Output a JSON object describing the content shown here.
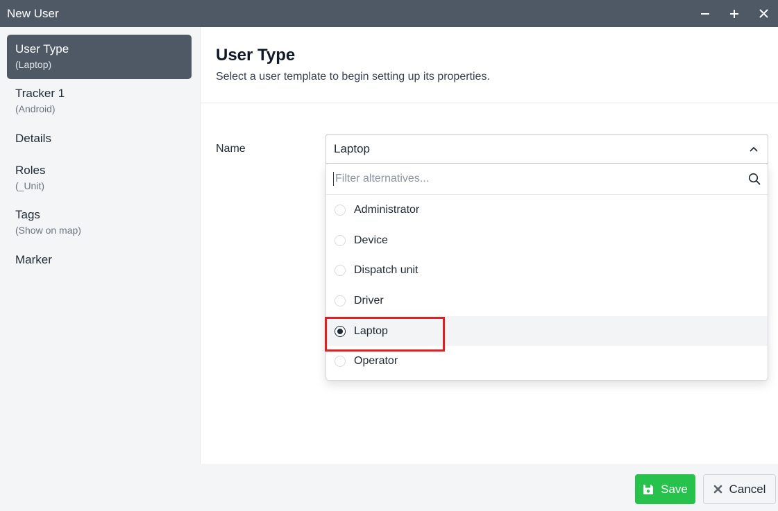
{
  "window": {
    "title": "New User",
    "controls": [
      "minimize-icon",
      "maximize-icon",
      "close-icon"
    ]
  },
  "sidebar": {
    "items": [
      {
        "label": "User Type",
        "sub": "(Laptop)",
        "active": true
      },
      {
        "label": "Tracker 1",
        "sub": "(Android)"
      },
      {
        "label": "Details",
        "sub": ""
      },
      {
        "label": "Roles",
        "sub": "(_Unit)"
      },
      {
        "label": "Tags",
        "sub": "(Show on map)"
      },
      {
        "label": "Marker",
        "sub": ""
      }
    ]
  },
  "main": {
    "title": "User Type",
    "subtitle": "Select a user template to begin setting up its properties.",
    "name_label": "Name",
    "select": {
      "value": "Laptop",
      "filter_placeholder": "Filter alternatives...",
      "options": [
        "Administrator",
        "Device",
        "Dispatch unit",
        "Driver",
        "Laptop",
        "Operator"
      ],
      "selected": "Laptop"
    }
  },
  "footer": {
    "save_label": "Save",
    "cancel_label": "Cancel"
  },
  "colors": {
    "titlebar": "#4f5965",
    "save": "#27c24c",
    "highlight": "#e02020"
  }
}
